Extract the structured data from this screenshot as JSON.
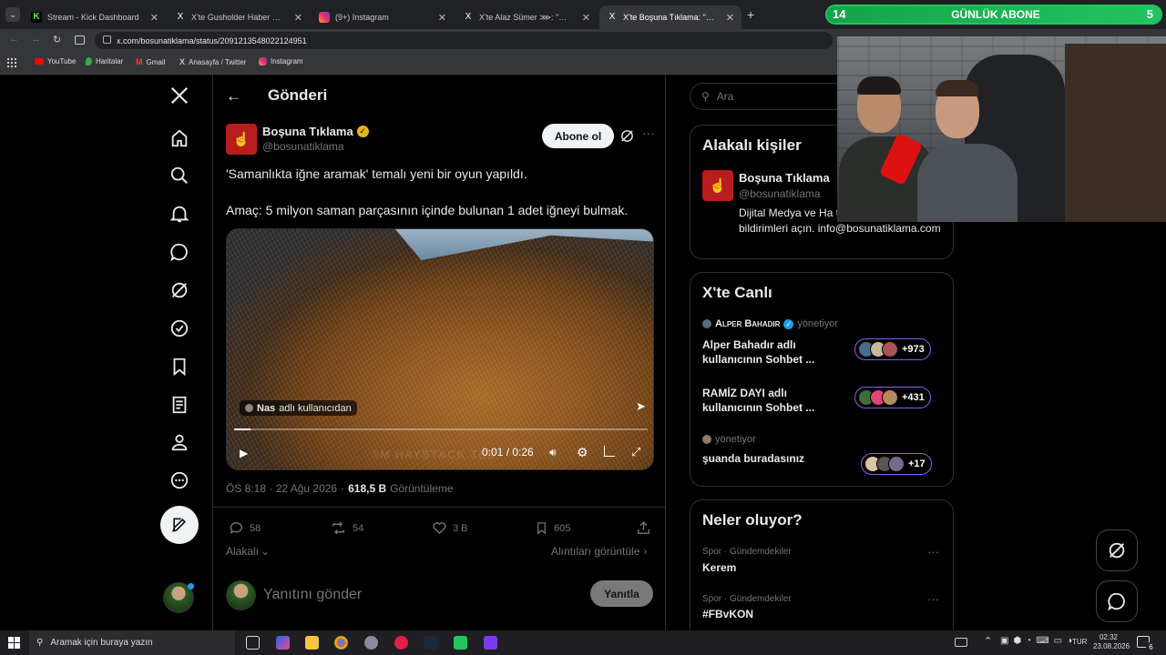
{
  "browser": {
    "tabs": [
      {
        "title": "Stream - Kick Dashboard",
        "favicon_color": "#53fc18",
        "favicon": "kick-icon"
      },
      {
        "title": "X'te Gusholder Haber Bülteni: \"",
        "favicon_color": "#000000",
        "favicon": "x-logo-icon"
      },
      {
        "title": "(9+) Instagram",
        "favicon_color": "#e1306c",
        "favicon": "instagram-icon"
      },
      {
        "title": "X'te Alaz Sümer ⋙: \"Hayatımda",
        "favicon_color": "#000000",
        "favicon": "x-logo-icon"
      },
      {
        "title": "X'te Boşuna Tıklama: \"Samanlık",
        "favicon_color": "#000000",
        "favicon": "x-logo-icon"
      }
    ],
    "url": "x.com/bosunatiklama/status/2091213548022124951",
    "bookmarks": [
      {
        "label": "YouTube",
        "color": "#ff0000"
      },
      {
        "label": "Haritalar",
        "color": "#34a853"
      },
      {
        "label": "Gmail",
        "color": "#ea4335"
      },
      {
        "label": "Anasayfa / Twitter",
        "color": "#ffffff"
      },
      {
        "label": "Instagram",
        "color": "#e1306c"
      }
    ]
  },
  "overlay": {
    "left": "14",
    "title": "GÜNLÜK ABONE",
    "right": "5",
    "color": "#22c55e"
  },
  "post": {
    "header": "Gönderi",
    "author": {
      "name": "Boşuna Tıklama",
      "handle": "@bosunatiklama"
    },
    "follow": "Abone ol",
    "text1": "'Samanlıkta iğne aramak' temalı yeni bir oyun yapıldı.",
    "text2": "Amaç: 5 milyon saman parçasının içinde bulunan 1 adet iğneyi bulmak.",
    "video": {
      "credit_name": "Nas",
      "credit_rest": "adlı kullanıcıdan",
      "time": "0:01 / 0:26",
      "watermark": "5M HAYSTACK TES",
      "progress": 0.04
    },
    "timestamp": "ÖS 8:18 · 22 Ağu 2026",
    "views_num": "618,5 B",
    "views_label": "Görüntüleme",
    "replies": "58",
    "reposts": "54",
    "likes": "3 B",
    "bookmarks": "605",
    "sort": "Alakalı",
    "quotes": "Alıntıları görüntüle",
    "reply_placeholder": "Yanıtını gönder",
    "reply_button": "Yanıtla"
  },
  "sidebar": {
    "search_placeholder": "Ara",
    "related": {
      "title": "Alakalı kişiler",
      "name": "Boşuna Tıklama",
      "handle": "@bosunatiklama",
      "bio": "Dijital Medya ve Ha tıkla takip etmek için bildirimleri açın. info@bosunatiklama.com"
    },
    "live": {
      "title": "X'te Canlı",
      "items": [
        {
          "host": "Alper Bahadır",
          "role": "yönetiyor",
          "title": "Alper Bahadır adlı kullanıcının Sohbet ...",
          "count": "+973"
        },
        {
          "host": "",
          "role": "",
          "title": "RAMİZ DAYI adlı kullanıcının Sohbet ...",
          "count": "+431"
        },
        {
          "host": "",
          "role": "yönetiyor",
          "title": "şuanda buradasınız",
          "count": "+17"
        }
      ]
    },
    "trends": {
      "title": "Neler oluyor?",
      "items": [
        {
          "category": "Spor · Gündemdekiler",
          "name": "Kerem"
        },
        {
          "category": "Spor · Gündemdekiler",
          "name": "#FBvKON"
        }
      ]
    }
  },
  "taskbar": {
    "search": "Aramak için buraya yazın",
    "lang": "TUR",
    "time": "02:32",
    "date": "23.08.2026",
    "notif": "6"
  }
}
